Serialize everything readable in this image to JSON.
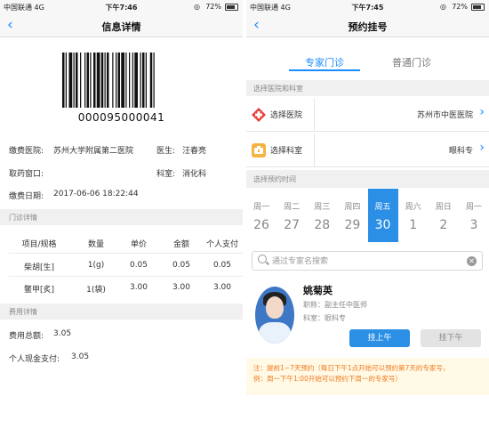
{
  "left": {
    "status": {
      "carrier": "中国联通  4G",
      "time": "下午7:46",
      "battery": "72%"
    },
    "nav": {
      "title": "信息详情"
    },
    "barcode": {
      "number": "000095000041"
    },
    "info": {
      "hospital_label": "缴费医院:",
      "hospital": "苏州大学附属第二医院",
      "doctor_label": "医生:",
      "doctor": "汪春亮",
      "window_label": "取药窗口:",
      "window": "",
      "dept_label": "科室:",
      "dept": "消化科",
      "date_label": "缴费日期:",
      "date": "2017-06-06 18:22:44"
    },
    "clinic_section": "门诊详情",
    "table": {
      "headers": [
        "项目/规格",
        "数量",
        "单价",
        "金额",
        "个人支付"
      ],
      "rows": [
        [
          "柴胡[生]",
          "1(g)",
          "0.05",
          "0.05",
          "0.05"
        ],
        [
          "鳖甲[炙]",
          "1(袋)",
          "3.00",
          "3.00",
          "3.00"
        ]
      ]
    },
    "fee_section": "费用详情",
    "fees": {
      "total_label": "费用总额:",
      "total": "3.05",
      "cash_label": "个人现金支付:",
      "cash": "3.05"
    }
  },
  "right": {
    "status": {
      "carrier": "中国联通  4G",
      "time": "下午7:45",
      "battery": "72%"
    },
    "nav": {
      "title": "预约挂号"
    },
    "tabs": [
      "专家门诊",
      "普通门诊"
    ],
    "select_section": "选择医院和科室",
    "hospital_row": {
      "label": "选择医院",
      "value": "苏州市中医医院"
    },
    "dept_row": {
      "label": "选择科室",
      "value": "眼科专"
    },
    "time_section": "选择预约时间",
    "days": [
      {
        "wk": "周一",
        "d": "26"
      },
      {
        "wk": "周二",
        "d": "27"
      },
      {
        "wk": "周三",
        "d": "28"
      },
      {
        "wk": "周四",
        "d": "29"
      },
      {
        "wk": "周五",
        "d": "30",
        "selected": true
      },
      {
        "wk": "周六",
        "d": "1"
      },
      {
        "wk": "周日",
        "d": "2"
      },
      {
        "wk": "周一",
        "d": "3"
      }
    ],
    "search": {
      "placeholder": "通过专家名搜索"
    },
    "doctor": {
      "name": "姚菊英",
      "title": "职称：副主任中医师",
      "dept": "科室：眼科专",
      "am_button": "挂上午",
      "pm_button": "挂下午"
    },
    "note": {
      "line1": "注：提前1~7天预约（每日下午1点开始可以预约第7天的专家号，",
      "line2": "例：周一下午1:00开始可以预约下周一的专家号）"
    },
    "colors": {
      "accent": "#1a8cff",
      "selected_day": "#2b8fe6",
      "note_text": "#f07a1d"
    }
  }
}
